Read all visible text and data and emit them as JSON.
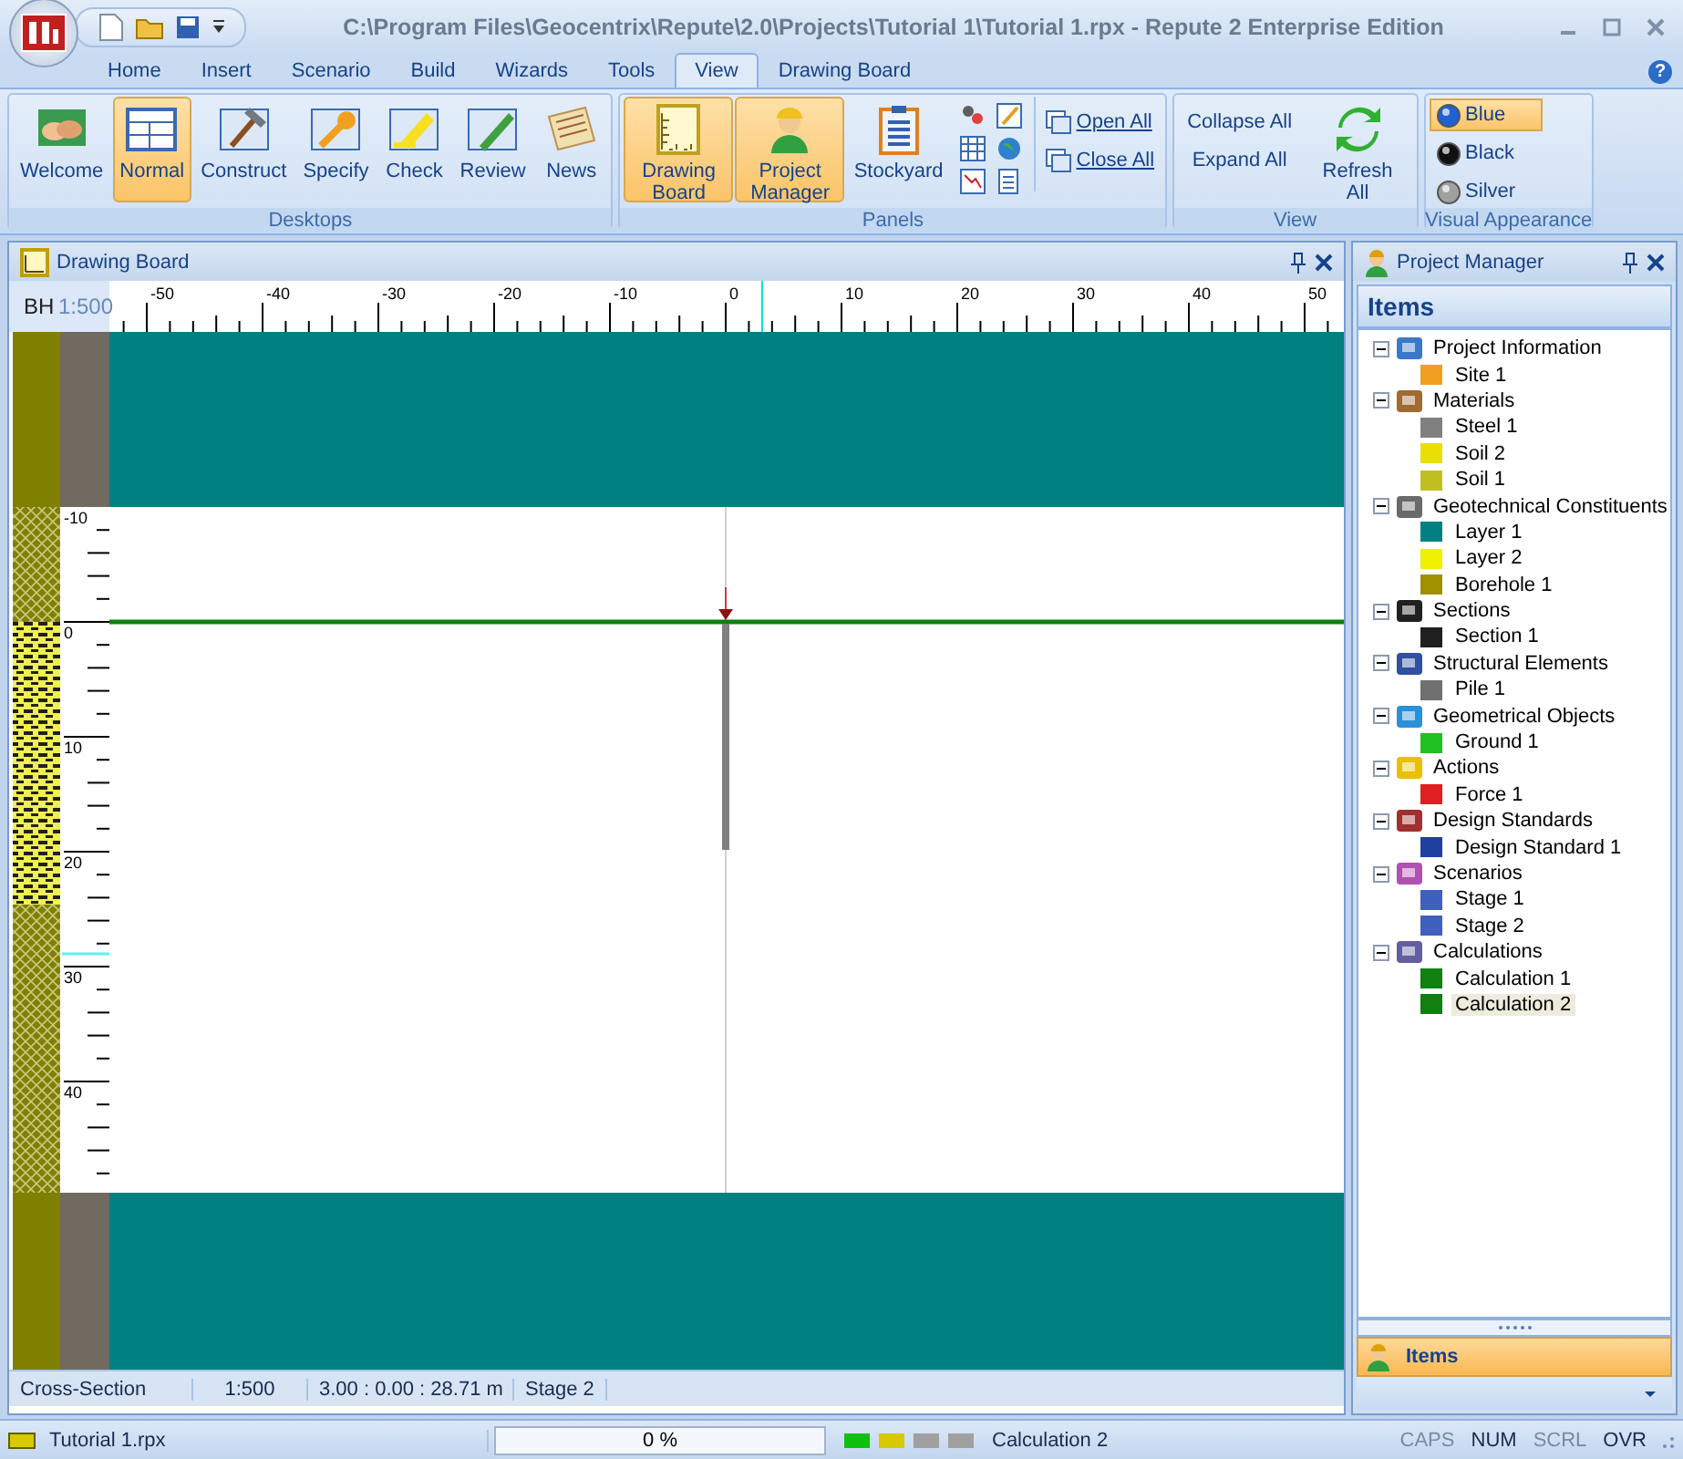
{
  "window": {
    "title": "C:\\Program Files\\Geocentrix\\Repute\\2.0\\Projects\\Tutorial 1\\Tutorial 1.rpx - Repute 2 Enterprise Edition",
    "help": "?"
  },
  "tabs": [
    {
      "label": "Home",
      "selected": false
    },
    {
      "label": "Insert",
      "selected": false
    },
    {
      "label": "Scenario",
      "selected": false
    },
    {
      "label": "Build",
      "selected": false
    },
    {
      "label": "Wizards",
      "selected": false
    },
    {
      "label": "Tools",
      "selected": false
    },
    {
      "label": "View",
      "selected": true
    },
    {
      "label": "Drawing Board",
      "selected": false
    }
  ],
  "ribbon": [
    {
      "title": "Desktops",
      "items": [
        {
          "kind": "large",
          "label": "Welcome",
          "selected": false
        },
        {
          "kind": "large",
          "label": "Normal",
          "selected": true
        },
        {
          "kind": "large",
          "label": "Construct",
          "selected": false
        },
        {
          "kind": "large",
          "label": "Specify",
          "selected": false
        },
        {
          "kind": "large",
          "label": "Check",
          "selected": false
        },
        {
          "kind": "large",
          "label": "Review",
          "selected": false
        },
        {
          "kind": "large",
          "label": "News",
          "selected": false
        }
      ]
    },
    {
      "title": "Panels",
      "items": [
        {
          "kind": "large",
          "label": "Drawing Board",
          "selected": true
        },
        {
          "kind": "large",
          "label": "Project Manager",
          "selected": true
        },
        {
          "kind": "large",
          "label": "Stockyard",
          "selected": false
        },
        {
          "kind": "icons"
        },
        {
          "kind": "small",
          "label": "Open All"
        },
        {
          "kind": "small",
          "label": "Close All"
        }
      ]
    },
    {
      "title": "View",
      "items": [
        {
          "kind": "text",
          "label": "Collapse All"
        },
        {
          "kind": "text",
          "label": "Expand All"
        },
        {
          "kind": "large",
          "label": "Refresh All",
          "selected": false
        }
      ]
    },
    {
      "title": "Visual Appearance",
      "items": [
        {
          "kind": "radio",
          "label": "Blue",
          "selected": true
        },
        {
          "kind": "radio",
          "label": "Black",
          "selected": false
        },
        {
          "kind": "radio",
          "label": "Silver",
          "selected": false
        }
      ]
    }
  ],
  "drawing_board": {
    "title": "Drawing Board",
    "corner_label": "BH",
    "scale": "1:500",
    "x_labels": [
      "-50",
      "-40",
      "-30",
      "-20",
      "-10",
      "0",
      "10",
      "20",
      "30",
      "40",
      "50"
    ],
    "depth_labels": [
      "-10",
      "0",
      "10",
      "20",
      "30",
      "40"
    ],
    "status": [
      "Cross-Section",
      "1:500",
      "3.00 : 0.00 : 28.71 m",
      "Stage 2"
    ]
  },
  "project_manager": {
    "title": "Project Manager",
    "header": "Items",
    "footer_tab": "Items",
    "tree": [
      {
        "label": "Project Information",
        "expanded": true,
        "selected": false,
        "children": [
          {
            "label": "Site 1",
            "selected": false
          }
        ]
      },
      {
        "label": "Materials",
        "expanded": true,
        "selected": false,
        "children": [
          {
            "label": "Steel 1",
            "selected": false
          },
          {
            "label": "Soil 2",
            "selected": false
          },
          {
            "label": "Soil 1",
            "selected": false
          }
        ]
      },
      {
        "label": "Geotechnical Constituents",
        "expanded": true,
        "selected": false,
        "children": [
          {
            "label": "Layer 1",
            "selected": false
          },
          {
            "label": "Layer 2",
            "selected": false
          },
          {
            "label": "Borehole 1",
            "selected": false
          }
        ]
      },
      {
        "label": "Sections",
        "expanded": true,
        "selected": false,
        "children": [
          {
            "label": "Section 1",
            "selected": false
          }
        ]
      },
      {
        "label": "Structural Elements",
        "expanded": true,
        "selected": false,
        "children": [
          {
            "label": "Pile 1",
            "selected": false
          }
        ]
      },
      {
        "label": "Geometrical Objects",
        "expanded": true,
        "selected": false,
        "children": [
          {
            "label": "Ground 1",
            "selected": false
          }
        ]
      },
      {
        "label": "Actions",
        "expanded": true,
        "selected": false,
        "children": [
          {
            "label": "Force 1",
            "selected": false
          }
        ]
      },
      {
        "label": "Design Standards",
        "expanded": true,
        "selected": false,
        "children": [
          {
            "label": "Design Standard 1",
            "selected": false
          }
        ]
      },
      {
        "label": "Scenarios",
        "expanded": true,
        "selected": false,
        "children": [
          {
            "label": "Stage 1",
            "selected": false
          },
          {
            "label": "Stage 2",
            "selected": false
          }
        ]
      },
      {
        "label": "Calculations",
        "expanded": true,
        "selected": false,
        "children": [
          {
            "label": "Calculation 1",
            "selected": false
          },
          {
            "label": "Calculation 2",
            "selected": true
          }
        ]
      }
    ]
  },
  "status_bar": {
    "file": "Tutorial 1.rpx",
    "progress": {
      "text": "0 %",
      "level": 0
    },
    "lights": [
      {
        "color": "#10c010"
      },
      {
        "color": "#d8c800"
      },
      {
        "color": "#a0a0a0"
      },
      {
        "color": "#a0a0a0"
      }
    ],
    "message": "Calculation 2",
    "keys": [
      {
        "label": "CAPS",
        "on": false
      },
      {
        "label": "NUM",
        "on": true
      },
      {
        "label": "SCRL",
        "on": false
      },
      {
        "label": "OVR",
        "on": true
      }
    ]
  }
}
